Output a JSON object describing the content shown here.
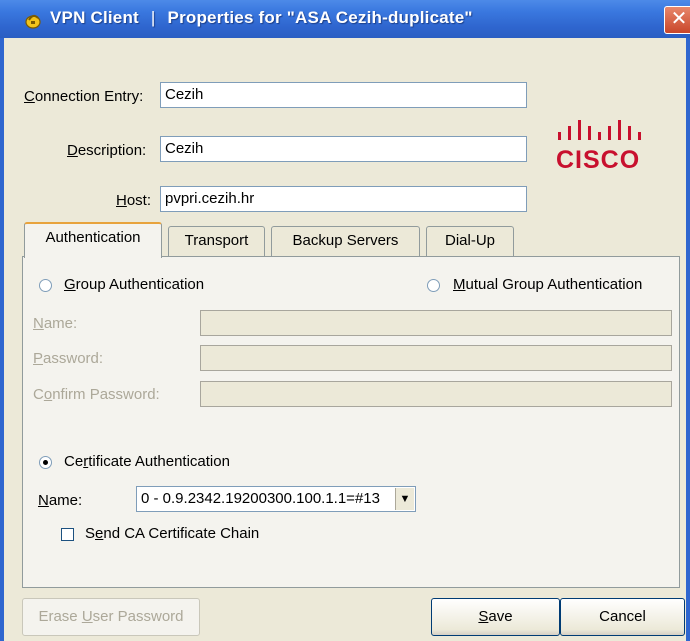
{
  "window": {
    "app_name": "VPN Client",
    "title": "Properties for \"ASA Cezih-duplicate\"",
    "close_glyph": "✕"
  },
  "connection_entry": {
    "label_u": "C",
    "label_rest": "onnection Entry:",
    "value": "Cezih"
  },
  "description": {
    "label_u": "D",
    "label_rest": "escription:",
    "value": "Cezih"
  },
  "host": {
    "label_u": "H",
    "label_rest": "ost:",
    "value": "pvpri.cezih.hr"
  },
  "logo": {
    "text": "CISCO",
    "color": "#c8102e"
  },
  "tabs": [
    {
      "label": "Authentication",
      "active": true
    },
    {
      "label": "Transport",
      "active": false
    },
    {
      "label": "Backup Servers",
      "active": false
    },
    {
      "label": "Dial-Up",
      "active": false
    }
  ],
  "auth": {
    "group_auth": {
      "label_u": "G",
      "label_rest": "roup Authentication",
      "checked": false
    },
    "mutual_auth": {
      "label_u": "M",
      "label_rest": "utual Group Authentication",
      "checked": false
    },
    "group_name": {
      "label_u": "N",
      "label_rest": "ame:",
      "value": ""
    },
    "group_password": {
      "label_u": "P",
      "label_rest": "assword:",
      "value": ""
    },
    "group_confirm": {
      "label_pre": "C",
      "label_u": "o",
      "label_rest": "nfirm Password:",
      "value": ""
    },
    "cert_auth": {
      "label_pre": "Ce",
      "label_u": "r",
      "label_rest": "tificate Authentication",
      "checked": true
    },
    "cert_name": {
      "label_u": "N",
      "label_rest": "ame:",
      "value": "0 - 0.9.2342.19200300.100.1.1=#13"
    },
    "send_ca": {
      "label_pre": "S",
      "label_u": "e",
      "label_rest": "nd CA Certificate Chain",
      "checked": false
    }
  },
  "buttons": {
    "erase": {
      "pre": "Erase ",
      "u": "U",
      "rest": "ser Password"
    },
    "save": {
      "pre": "",
      "u": "S",
      "rest": "ave"
    },
    "cancel": {
      "label": "Cancel"
    }
  }
}
